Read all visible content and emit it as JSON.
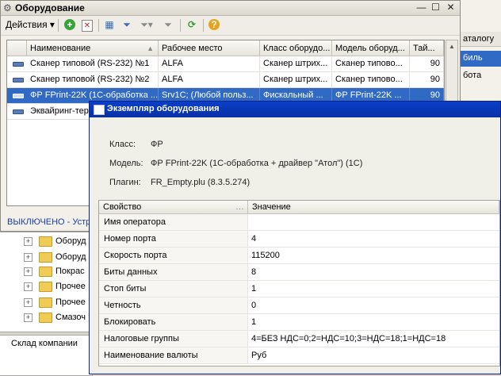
{
  "main_window": {
    "title": "Оборудование",
    "toolbar": {
      "actions_label": "Действия"
    },
    "table": {
      "columns": [
        "Наименование",
        "Рабочее место",
        "Класс оборудо...",
        "Модель оборуд...",
        "Тай..."
      ],
      "rows": [
        {
          "name": "Сканер типовой (RS-232) №1",
          "workplace": "ALFA",
          "class": "Сканер штрих...",
          "model": "Сканер типово...",
          "timeout": "90",
          "selected": false
        },
        {
          "name": "Сканер типовой (RS-232) №2",
          "workplace": "ALFA",
          "class": "Сканер штрих...",
          "model": "Сканер типово...",
          "timeout": "90",
          "selected": false
        },
        {
          "name": "ФР FPrint-22K (1С-обработка ...",
          "workplace": "Srv1C; (Любой польз...",
          "class": "Фискальный ...",
          "model": "ФР FPrint-22K ...",
          "timeout": "90",
          "selected": true
        },
        {
          "name": "Эквайринг-тер",
          "workplace": "",
          "class": "",
          "model": "",
          "timeout": "",
          "selected": false
        }
      ]
    },
    "status_text": "ВЫКЛЮЧЕНО - Устр"
  },
  "background": {
    "right_panel": {
      "header": "аталогу",
      "selected_item": "биль",
      "item2": "бота"
    },
    "tree_items": [
      "Оборуд",
      "Оборуд",
      "Покрас",
      "Прочее",
      "Прочее",
      "Смазоч"
    ],
    "warehouse_label": "Склад компании"
  },
  "dialog": {
    "title": "Экземпляр оборудования",
    "class_label": "Класс:",
    "class_value": "ФР",
    "model_label": "Модель:",
    "model_value": "ФР FPrint-22K (1С-обработка + драйвер \"Атол\") (1С)",
    "plugin_label": "Плагин:",
    "plugin_value": "FR_Empty.plu (8.3.5.274)",
    "columns": {
      "property": "Свойство",
      "value": "Значение"
    },
    "properties": [
      {
        "name": "Имя оператора",
        "value": ""
      },
      {
        "name": "Номер порта",
        "value": "4"
      },
      {
        "name": "Скорость порта",
        "value": "115200"
      },
      {
        "name": "Биты данных",
        "value": "8"
      },
      {
        "name": "Стоп биты",
        "value": "1"
      },
      {
        "name": "Четность",
        "value": "0"
      },
      {
        "name": "Блокировать",
        "value": "1"
      },
      {
        "name": "Налоговые группы",
        "value": "4=БЕЗ НДС=0;2=НДС=10;3=НДС=18;1=НДС=18"
      },
      {
        "name": "Наименование валюты",
        "value": "Руб"
      }
    ]
  },
  "colors": {
    "selection": "#316ac5",
    "dialog_title": "#0a3ec8",
    "status_text": "#1f3ea8"
  }
}
